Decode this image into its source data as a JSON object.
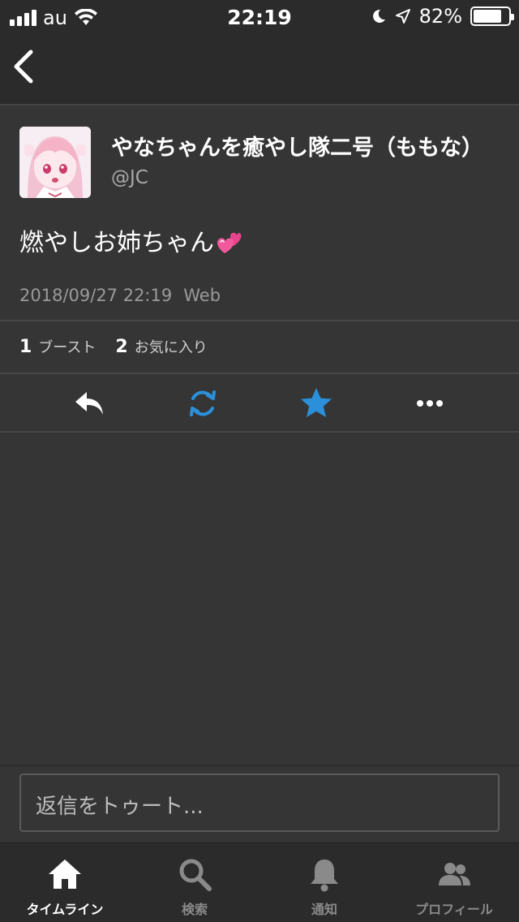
{
  "status_bar": {
    "carrier": "au",
    "time": "22:19",
    "battery": "82%",
    "battery_level": 0.82
  },
  "toot": {
    "display_name": "やなちゃんを癒やし隊二号（ももな）",
    "acct": "@JC",
    "content": "燃やしお姉ちゃん",
    "emoji": "revolving-hearts-icon",
    "date": "2018/09/27 22:19",
    "app": "Web"
  },
  "counts": {
    "boosts": "1",
    "boosts_label": "ブースト",
    "favourites": "2",
    "favourites_label": "お気に入り"
  },
  "actions": {
    "reply_icon": "reply-icon",
    "boost_icon": "boost-icon",
    "favourite_icon": "star-icon",
    "more_icon": "more-icon"
  },
  "reply": {
    "placeholder": "返信をトゥート..."
  },
  "tabs": [
    {
      "label": "タイムライン",
      "icon": "home-icon",
      "active": true
    },
    {
      "label": "検索",
      "icon": "search-icon",
      "active": false
    },
    {
      "label": "通知",
      "icon": "bell-icon",
      "active": false
    },
    {
      "label": "プロフィール",
      "icon": "profile-icon",
      "active": false
    }
  ],
  "colors": {
    "accent": "#2b90d9",
    "background": "#353535",
    "bar": "#2b2b2b"
  }
}
